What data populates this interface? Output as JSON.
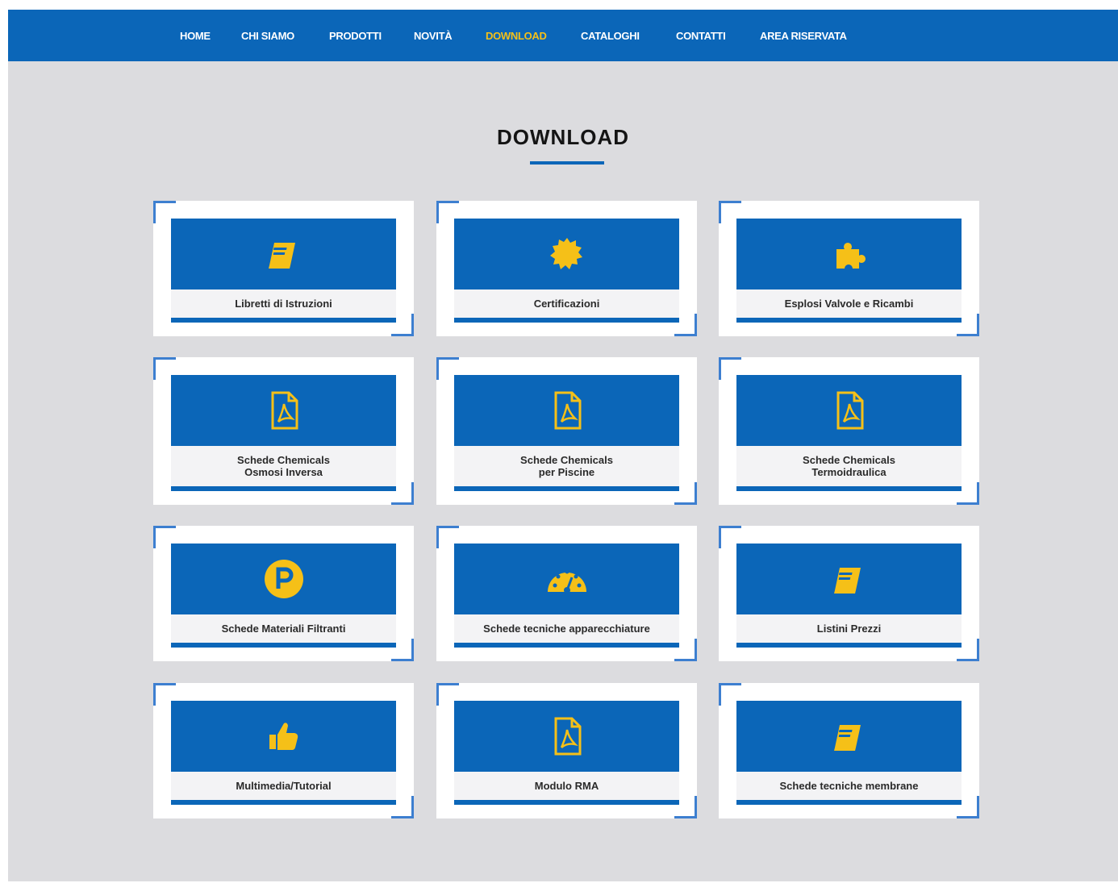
{
  "nav": {
    "items": [
      {
        "label": "HOME",
        "active": false
      },
      {
        "label": "CHI SIAMO",
        "active": false
      },
      {
        "label": "PRODOTTI",
        "active": false
      },
      {
        "label": "NOVITÀ",
        "active": false
      },
      {
        "label": "DOWNLOAD",
        "active": true
      },
      {
        "label": "CATALOGHI",
        "active": false
      },
      {
        "label": "CONTATTI",
        "active": false
      },
      {
        "label": "AREA RISERVATA",
        "active": false
      }
    ]
  },
  "page": {
    "title": "DOWNLOAD"
  },
  "cards": [
    {
      "label": "Libretti di Istruzioni",
      "icon": "book-icon"
    },
    {
      "label": "Certificazioni",
      "icon": "certificate-icon"
    },
    {
      "label": "Esplosi Valvole e Ricambi",
      "icon": "puzzle-icon"
    },
    {
      "label": "Schede Chemicals\nOsmosi Inversa",
      "icon": "pdf-icon"
    },
    {
      "label": "Schede Chemicals\nper Piscine",
      "icon": "pdf-icon"
    },
    {
      "label": "Schede Chemicals\nTermoidraulica",
      "icon": "pdf-icon"
    },
    {
      "label": "Schede Materiali Filtranti",
      "icon": "product-p-icon"
    },
    {
      "label": "Schede tecniche apparecchiature",
      "icon": "gauge-icon"
    },
    {
      "label": "Listini Prezzi",
      "icon": "book-icon"
    },
    {
      "label": "Multimedia/Tutorial",
      "icon": "thumbs-up-icon"
    },
    {
      "label": "Modulo RMA",
      "icon": "pdf-icon"
    },
    {
      "label": "Schede tecniche membrane",
      "icon": "book-icon"
    }
  ],
  "colors": {
    "brand_blue": "#0b66b8",
    "accent_yellow": "#f5c018",
    "background": "#dcdcdf"
  }
}
